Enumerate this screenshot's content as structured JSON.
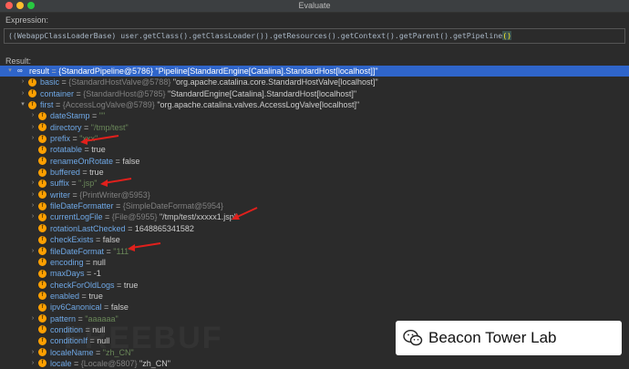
{
  "window": {
    "title": "Evaluate"
  },
  "expression": {
    "label": "Expression:",
    "before": "((WebappClassLoaderBase) user.getClass().getClassLoader()).getResources().getContext().getParent().getPipeline",
    "paren": "()"
  },
  "result_label": "Result:",
  "tree": [
    {
      "k": "result",
      "t": "{StandardPipeline@5786}",
      "v": "\"Pipeline[StandardEngine[Catalina].StandardHost[localhost]]\""
    },
    {
      "k": "basic",
      "t": "{StandardHostValve@5788}",
      "v": "\"org.apache.catalina.core.StandardHostValve[localhost]\""
    },
    {
      "k": "container",
      "t": "{StandardHost@5785}",
      "v": "\"StandardEngine[Catalina].StandardHost[localhost]\""
    },
    {
      "k": "first",
      "t": "{AccessLogValve@5789}",
      "v": "\"org.apache.catalina.valves.AccessLogValve[localhost]\""
    },
    {
      "k": "dateStamp",
      "e": " = ",
      "s": "\"\""
    },
    {
      "k": "directory",
      "e": " = ",
      "s": "\"/tmp/test\""
    },
    {
      "k": "prefix",
      "e": " = ",
      "s": "\"xxx\""
    },
    {
      "k": "rotatable",
      "e": " = ",
      "v": "true"
    },
    {
      "k": "renameOnRotate",
      "e": " = ",
      "v": "false"
    },
    {
      "k": "buffered",
      "e": " = ",
      "v": "true"
    },
    {
      "k": "suffix",
      "e": " = ",
      "s": "\".jsp\""
    },
    {
      "k": "writer",
      "e": " = ",
      "t": "{PrintWriter@5953}"
    },
    {
      "k": "fileDateFormatter",
      "e": " = ",
      "t": "{SimpleDateFormat@5954}"
    },
    {
      "k": "currentLogFile",
      "e": " = ",
      "t": "{File@5955}",
      "v": "\"/tmp/test/xxxxx1.jsp\""
    },
    {
      "k": "rotationLastChecked",
      "e": " = ",
      "v": "1648865341582"
    },
    {
      "k": "checkExists",
      "e": " = ",
      "v": "false"
    },
    {
      "k": "fileDateFormat",
      "e": " = ",
      "s": "\"111\""
    },
    {
      "k": "encoding",
      "e": " = ",
      "v": "null"
    },
    {
      "k": "maxDays",
      "e": " = ",
      "v": "-1"
    },
    {
      "k": "checkForOldLogs",
      "e": " = ",
      "v": "true"
    },
    {
      "k": "enabled",
      "e": " = ",
      "v": "true"
    },
    {
      "k": "ipv6Canonical",
      "e": " = ",
      "v": "false"
    },
    {
      "k": "pattern",
      "e": " = ",
      "s": "\"aaaaaa\""
    },
    {
      "k": "condition",
      "e": " = ",
      "v": "null"
    },
    {
      "k": "conditionIf",
      "e": " = ",
      "v": "null"
    },
    {
      "k": "localeName",
      "e": " = ",
      "s": "\"zh_CN\""
    },
    {
      "k": "locale",
      "e": " = ",
      "t": "{Locale@5807}",
      "v": "\"zh_CN\""
    }
  ],
  "watermark": {
    "text": "Beacon Tower Lab",
    "bg": "FREEBUF"
  },
  "colors": {
    "selection": "#2f65ca",
    "key": "#6fa8e6",
    "string": "#6a8759",
    "annotation": "#e0201c"
  }
}
